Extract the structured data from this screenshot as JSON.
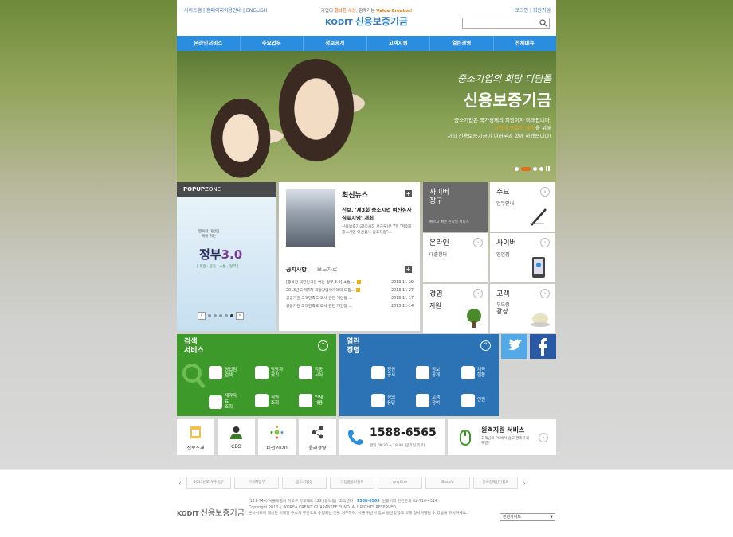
{
  "header": {
    "util_left": "사이트맵 | 홈페이지이용안내 | ENGLISH",
    "util_right": "로그인 | 회원가입",
    "slogan_pre": "기업이",
    "slogan_hl": "행복한 세상,",
    "slogan_mid": "함께가는",
    "slogan_vc": "Value Creator!",
    "logo_mark": "KODIT",
    "logo_name": "신용보증기금",
    "search_placeholder": ""
  },
  "nav": [
    "온라인서비스",
    "주요업무",
    "정보공개",
    "고객지원",
    "열린경영",
    "전체메뉴"
  ],
  "hero": {
    "subtitle": "중소기업의 희망 디딤돌",
    "title": "신용보증기금",
    "line1": "중소기업은 국가경제의 희망이자 미래입니다.",
    "line2_hl": "기업이 행복한 세상",
    "line2_rest": "을 위해",
    "line3": "저희 신용보증기금이 여러분과 함께 하겠습니다!"
  },
  "popup": {
    "head_bold": "POPUP",
    "head_rest": "ZONE",
    "caption": "행복한 대한민국을 여는",
    "title_main": "정부",
    "title_num": "3.0",
    "tags": "[ 개방 · 공유 · 소통 · 협력 ]",
    "prev": "‹",
    "next": "›"
  },
  "news": {
    "title": "최신뉴스",
    "more": "+",
    "headline": "신보, '제3회 중소시업 여신심사 심포지엄' 개최",
    "body": "신용보증기금(이사장 서근우)은 7일 \"제3회 중소시업 여신심사 심포지엄\"...",
    "notice_tab": "공지사항",
    "press_tab": "보도자료",
    "notice_more": "+",
    "notices": [
      {
        "title": "[행복한 대한민국을 여는 정부 3.0] 소통 …",
        "date": "2013-11-29"
      },
      {
        "title": "2013년도 제4차 희망창업아카데미 모집…",
        "date": "2013-11-27"
      },
      {
        "title": "공공기관 고객만족도 조사 관련 개인정 …",
        "date": "2013-11-17"
      },
      {
        "title": "공공기관 고객만족도 조사 관련 개인정 …",
        "date": "2013-11-14"
      }
    ]
  },
  "tiles": {
    "cyber": {
      "l1": "사이버",
      "l2": "창구",
      "sub": "빠르고 빠른 온라인 서비스"
    },
    "major": {
      "l1": "주요",
      "sub": "업무안내",
      "arrow": "›"
    },
    "online": {
      "l1": "온라인",
      "sub": "대출창터",
      "arrow": "›"
    },
    "cyberb": {
      "l1": "사이버",
      "sub": "영업점",
      "arrow": "›"
    },
    "mgmt": {
      "l1": "경영",
      "sub": "지원",
      "arrow": "›"
    },
    "customer": {
      "l1": "고객",
      "sub": "두드림",
      "sub2": "광장",
      "arrow": "›"
    }
  },
  "search_services": {
    "title1": "검색",
    "title2": "서비스",
    "toggle": "^",
    "items": [
      {
        "l1": "영업점",
        "l2": "검색"
      },
      {
        "l1": "담당자",
        "l2": "찾기"
      },
      {
        "l1": "각종",
        "l2": "서식"
      },
      {
        "l1": "제각자료",
        "l2": "조회"
      },
      {
        "l1": "직원",
        "l2": "조회"
      },
      {
        "l1": "인재",
        "l2": "채용"
      }
    ]
  },
  "open_mgmt": {
    "title1": "열린",
    "title2": "경영",
    "toggle": "^",
    "items": [
      {
        "l1": "경영",
        "l2": "공시"
      },
      {
        "l1": "정보",
        "l2": "공개"
      },
      {
        "l1": "계약",
        "l2": "현황"
      },
      {
        "l1": "칭의",
        "l2": "응답"
      },
      {
        "l1": "고객",
        "l2": "참여"
      },
      {
        "l1": "민원",
        "l2": ""
      }
    ]
  },
  "quick": [
    "신보소개",
    "CEO",
    "비전2020",
    "윤리경영"
  ],
  "phone": {
    "number": "1588-6565",
    "hours": "평일 09:30 ~ 18:00 (공휴일 휴무)"
  },
  "remote": {
    "title": "원격지원 서비스",
    "desc": "고객님의 PC에서 쉽고 편리하게 해결!",
    "arrow": "›"
  },
  "banners": [
    "2013년도 우수업무",
    "기획재정부",
    "중소기업청",
    "기업금융나들목",
    "AnyOne",
    "Bizinfo",
    "전국경제인연합회"
  ],
  "footer": {
    "logo_mark": "KODIT",
    "logo_name": "신용보증기금",
    "addr": "(121-744) 서울특별시 마포구 마포대로 122 (공덕동)",
    "center_label": "고객센터 :",
    "center_phone": "1588-6565",
    "center_extra": "원활이지 관련문의 02-710-4314",
    "copyright": "Copyright 2013 ⓒ KOREA CREDIT GUARANTEE FUND. ALL RIGHTS RESERVED.",
    "notice": "본사이트에 게시된 이메일 주소가 무단으로 수집되는 것을 거부하며, 이를 위반시 정보 통신망법에 의해 형사처벌될 수 있음을 유의하세요.",
    "related": "관련사이트"
  }
}
